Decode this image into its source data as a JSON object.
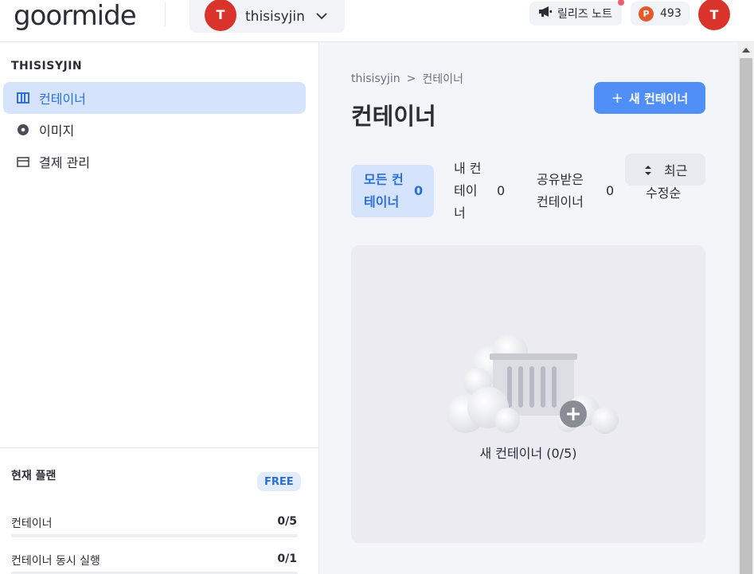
{
  "header": {
    "logo": "goormide",
    "workspace": {
      "avatar_initial": "T",
      "name": "thisisyjin"
    },
    "release_notes_label": "릴리즈 노트",
    "points_badge": "P",
    "points_value": "493",
    "user_avatar_initial": "T"
  },
  "sidebar": {
    "title": "THISISYJIN",
    "items": [
      {
        "label": "컨테이너",
        "icon": "container-icon",
        "active": true
      },
      {
        "label": "이미지",
        "icon": "image-disc-icon",
        "active": false
      },
      {
        "label": "결제 관리",
        "icon": "credit-card-icon",
        "active": false
      }
    ],
    "plan": {
      "title": "현재 플랜",
      "badge": "FREE",
      "usage": [
        {
          "label": "컨테이너",
          "value": "0/5",
          "fraction": 0
        },
        {
          "label": "컨테이너 동시 실행",
          "value": "0/1",
          "fraction": 0
        }
      ]
    }
  },
  "main": {
    "breadcrumb": [
      "thisisyjin",
      "컨테이너"
    ],
    "breadcrumb_sep": ">",
    "title": "컨테이너",
    "new_button": {
      "icon": "+",
      "label": "새 컨테이너"
    },
    "tabs": [
      {
        "line1": "모든 컨",
        "line2": "테이너",
        "line3": "",
        "count": "0",
        "active": true
      },
      {
        "line1": "내 컨",
        "line2": "테이",
        "line3": "너",
        "count": "0",
        "active": false
      },
      {
        "line1": "공유받은",
        "line2": "컨테이너",
        "line3": "",
        "count": "0",
        "active": false
      }
    ],
    "sort": {
      "line1": "최근",
      "line2": "수정순"
    },
    "empty_state": {
      "label": "새 컨테이너 (0/5)"
    }
  },
  "colors": {
    "primary": "#4f8ff7",
    "active_bg": "#d5e4fc",
    "active_text": "#2c6fd6",
    "avatar": "#d9342b",
    "notif": "#ef5c6e"
  }
}
